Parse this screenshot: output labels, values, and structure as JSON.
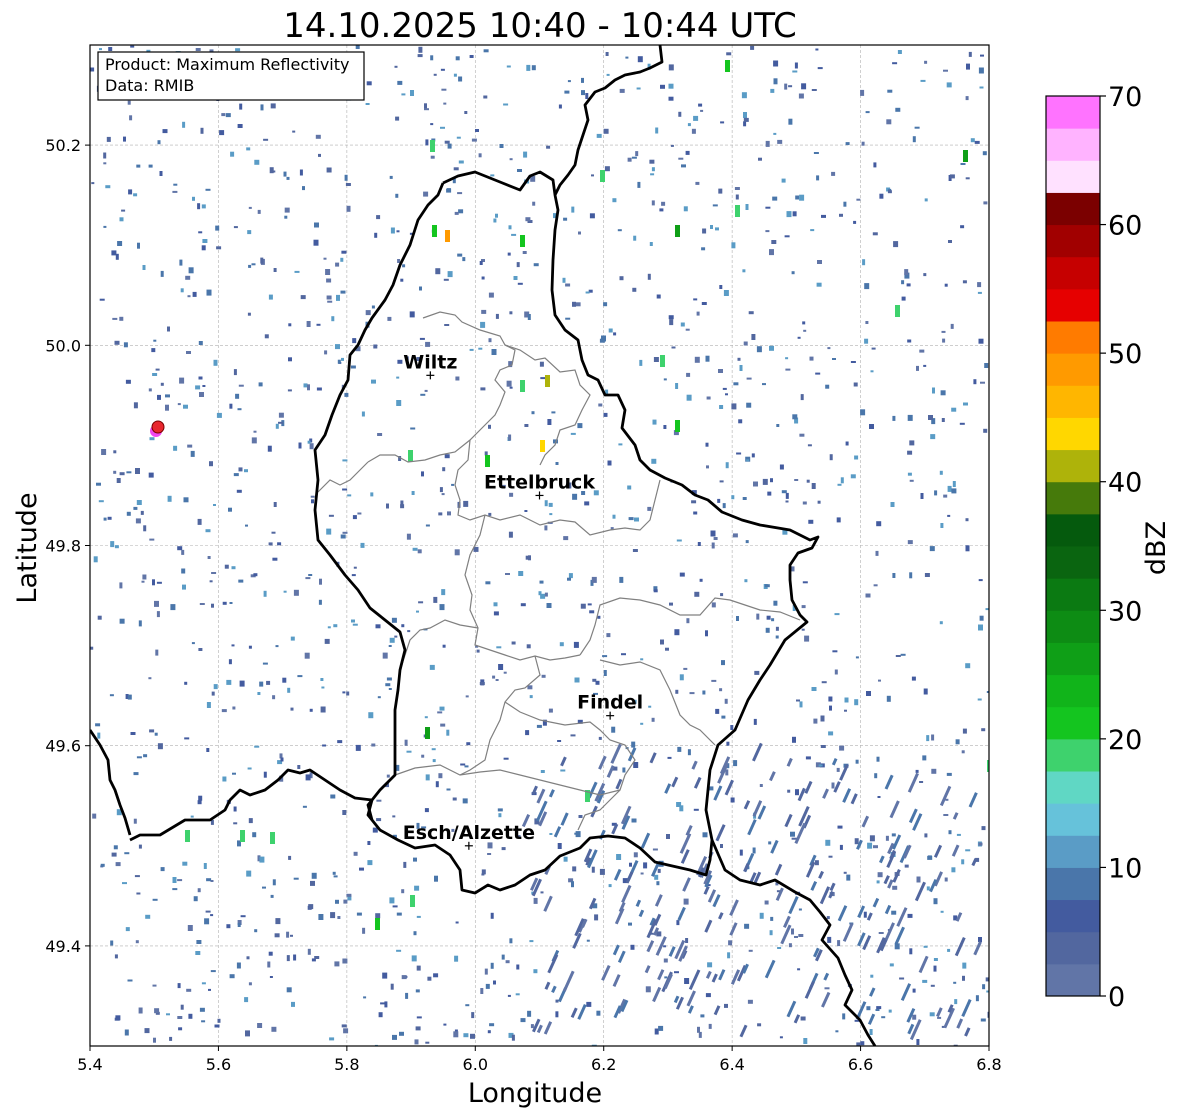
{
  "title": "14.10.2025 10:40 - 10:44 UTC",
  "info_box": {
    "product": "Product: Maximum Reflectivity",
    "source": "Data: RMIB"
  },
  "axes": {
    "xlabel": "Longitude",
    "ylabel": "Latitude",
    "xlim": [
      5.4,
      6.8
    ],
    "ylim": [
      49.3,
      50.3
    ],
    "xticks": [
      "5.4",
      "5.6",
      "5.8",
      "6.0",
      "6.2",
      "6.4",
      "6.6",
      "6.8"
    ],
    "yticks": [
      "49.4",
      "49.6",
      "49.8",
      "50.0",
      "50.2"
    ],
    "grid": true
  },
  "colorbar": {
    "label": "dBZ",
    "ticks": [
      "0",
      "10",
      "20",
      "30",
      "40",
      "50",
      "60",
      "70"
    ],
    "range": [
      0,
      70
    ],
    "step": 2.5,
    "colors": [
      "#6175a7",
      "#52679f",
      "#435b9f",
      "#4a76aa",
      "#5a9cc6",
      "#66c2da",
      "#60d7c4",
      "#3ed26d",
      "#14c51f",
      "#11b41a",
      "#0f9f17",
      "#0d8c14",
      "#0b7a12",
      "#0a6510",
      "#055a0d",
      "#467a0b",
      "#aeb30a",
      "#ffd700",
      "#ffb600",
      "#ff9a00",
      "#ff7b00",
      "#e60000",
      "#c60000",
      "#a10000",
      "#7b0000",
      "#ffe1ff",
      "#ffb3ff",
      "#ff73ff",
      "#ee33ee"
    ]
  },
  "cities": [
    {
      "name": "Wiltz",
      "lon": 5.93,
      "lat": 49.97
    },
    {
      "name": "Ettelbruck",
      "lon": 6.1,
      "lat": 49.85
    },
    {
      "name": "Findel",
      "lon": 6.21,
      "lat": 49.63
    },
    {
      "name": "Esch/Alzette",
      "lon": 5.99,
      "lat": 49.5
    }
  ],
  "radar_site": {
    "lon": 5.505,
    "lat": 49.915,
    "color": "#e8262e"
  },
  "colors": {
    "national_border": "#000000",
    "canton_border": "#808080",
    "grid": "#b0b0b0"
  }
}
